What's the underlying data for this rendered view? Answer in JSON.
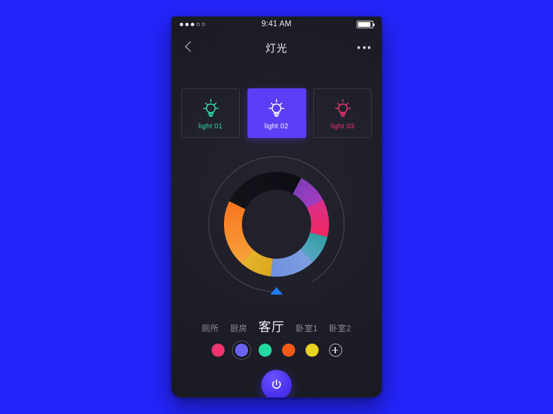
{
  "theme": {
    "page_background": "#2424fa",
    "screen_background": "#1d1d27",
    "accent": "#5b3ef5",
    "pointer_color": "#1f7af5"
  },
  "status_bar": {
    "signal_dots_filled": 3,
    "signal_dots_empty": 2,
    "time": "9:41 AM",
    "battery_level_percent": 92
  },
  "nav_bar": {
    "back_icon": "chevron-left-icon",
    "title": "灯光",
    "more_icon": "more-horizontal-icon"
  },
  "lights": [
    {
      "label": "light 01",
      "icon": "light-bulb-icon",
      "color": "#2ee0a8",
      "active": false
    },
    {
      "label": "light 02",
      "icon": "light-bulb-icon",
      "color": "#ffffff",
      "active": true
    },
    {
      "label": "light 03",
      "icon": "light-bulb-icon",
      "color": "#f0336e",
      "active": false
    }
  ],
  "dial": {
    "outer_ring_color": "#55555f",
    "track_color": "#101018",
    "pointer_icon": "triangle-up-icon",
    "pointer_angle_degrees": 180,
    "segments": [
      {
        "name": "violet",
        "start_deg": 28,
        "end_deg": 62,
        "from": "#7b3fb5",
        "to": "#a63cc4"
      },
      {
        "name": "magenta",
        "start_deg": 62,
        "end_deg": 104,
        "from": "#d8308f",
        "to": "#f0265c"
      },
      {
        "name": "teal",
        "start_deg": 104,
        "end_deg": 136,
        "from": "#2f9d9d",
        "to": "#5aa8c8"
      },
      {
        "name": "blue",
        "start_deg": 136,
        "end_deg": 186,
        "from": "#7fa0e0",
        "to": "#6f8fe0"
      },
      {
        "name": "gold",
        "start_deg": 186,
        "end_deg": 222,
        "from": "#d9a61f",
        "to": "#e8b52c"
      },
      {
        "name": "orange",
        "start_deg": 222,
        "end_deg": 296,
        "from": "#f6a43a",
        "to": "#f9731f"
      },
      {
        "name": "off",
        "start_deg": 296,
        "end_deg": 28,
        "from": "#121219",
        "to": "#0d0d14"
      }
    ]
  },
  "rooms": [
    {
      "label": "厕所",
      "active": false
    },
    {
      "label": "厨房",
      "active": false
    },
    {
      "label": "客厅",
      "active": true
    },
    {
      "label": "卧室1",
      "active": false
    },
    {
      "label": "卧室2",
      "active": false
    }
  ],
  "swatches": [
    {
      "color": "#f0336e",
      "selected": false
    },
    {
      "color": "#6a63f0",
      "selected": true
    },
    {
      "color": "#25d8a0",
      "selected": false
    },
    {
      "color": "#f35a17",
      "selected": false
    },
    {
      "color": "#e8d321",
      "selected": false
    }
  ],
  "add_swatch": {
    "icon": "plus-circle-icon",
    "label": "+"
  },
  "power_button": {
    "icon": "power-icon",
    "color": "#4a32ef",
    "state": "on"
  }
}
